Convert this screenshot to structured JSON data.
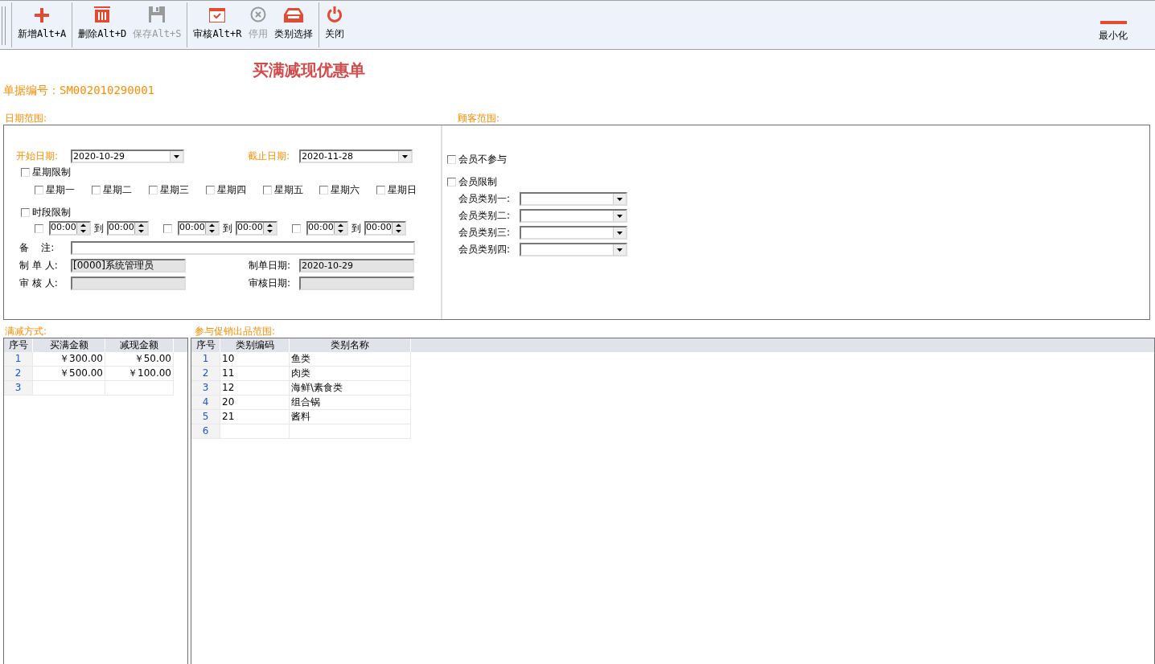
{
  "toolbar": {
    "groups": [
      [
        {
          "label": "新增Alt+A",
          "kind": "plus",
          "disabled": false
        }
      ],
      [
        {
          "label": "删除Alt+D",
          "kind": "trash",
          "disabled": false
        },
        {
          "label": "保存Alt+S",
          "kind": "save",
          "disabled": true
        }
      ],
      [
        {
          "label": "审核Alt+R",
          "kind": "review",
          "disabled": false
        },
        {
          "label": "停用",
          "kind": "stop",
          "disabled": true
        },
        {
          "label": "类别选择",
          "kind": "tray",
          "disabled": false
        }
      ],
      [
        {
          "label": "关闭",
          "kind": "power",
          "disabled": false
        }
      ]
    ],
    "minimize": {
      "label": "最小化"
    }
  },
  "title": "买满减现优惠单",
  "doc_number": {
    "label": "单据编号：",
    "value": "SM002010290001"
  },
  "date_range": {
    "legend": "日期范围:",
    "start": {
      "label": "开始日期:",
      "value": "2020-10-29"
    },
    "end": {
      "label": "截止日期:",
      "value": "2020-11-28"
    },
    "weekday_limit": {
      "label": "星期限制",
      "checked": false
    },
    "weekdays": [
      {
        "label": "星期一",
        "checked": false
      },
      {
        "label": "星期二",
        "checked": false
      },
      {
        "label": "星期三",
        "checked": false
      },
      {
        "label": "星期四",
        "checked": false
      },
      {
        "label": "星期五",
        "checked": false
      },
      {
        "label": "星期六",
        "checked": false
      },
      {
        "label": "星期日",
        "checked": false
      }
    ],
    "time_limit": {
      "label": "时段限制",
      "checked": false
    },
    "time_slots": [
      {
        "checked": false,
        "from": "00:00",
        "to_label": "到",
        "to": "00:00"
      },
      {
        "checked": false,
        "from": "00:00",
        "to_label": "到",
        "to": "00:00"
      },
      {
        "checked": false,
        "from": "00:00",
        "to_label": "到",
        "to": "00:00"
      }
    ],
    "remark": {
      "label": "备    注:"
    },
    "creator": {
      "label": "制 单 人:",
      "value": "[0000]系统管理员"
    },
    "created_date": {
      "label": "制单日期:",
      "value": "2020-10-29"
    },
    "reviewer": {
      "label": "审 核 人:"
    },
    "review_date": {
      "label": "审核日期:"
    }
  },
  "customer_range": {
    "legend": "顾客范围:",
    "no_member": {
      "label": "会员不参与",
      "checked": false
    },
    "member_limit": {
      "label": "会员限制",
      "checked": false
    },
    "member_categories": [
      {
        "label": "会员类别一:"
      },
      {
        "label": "会员类别二:"
      },
      {
        "label": "会员类别三:"
      },
      {
        "label": "会员类别四:"
      }
    ]
  },
  "discount_table": {
    "legend": "满减方式:",
    "columns": [
      "序号",
      "买满金额",
      "减现金额"
    ],
    "rows": [
      {
        "index": "1",
        "cells": [
          "￥300.00",
          "￥50.00"
        ]
      },
      {
        "index": "2",
        "cells": [
          "￥500.00",
          "￥100.00"
        ]
      },
      {
        "index": "3"
      }
    ]
  },
  "product_table": {
    "legend": "参与促销出品范围:",
    "columns": [
      "序号",
      "类别编码",
      "类别名称"
    ],
    "rows": [
      {
        "index": "1",
        "cells": [
          "10",
          "鱼类"
        ]
      },
      {
        "index": "2",
        "cells": [
          "11",
          "肉类"
        ]
      },
      {
        "index": "3",
        "cells": [
          "12",
          "海鲜\\素食类"
        ]
      },
      {
        "index": "4",
        "cells": [
          "20",
          "组合锅"
        ]
      },
      {
        "index": "5",
        "cells": [
          "21",
          "酱料"
        ]
      },
      {
        "index": "6"
      }
    ]
  }
}
